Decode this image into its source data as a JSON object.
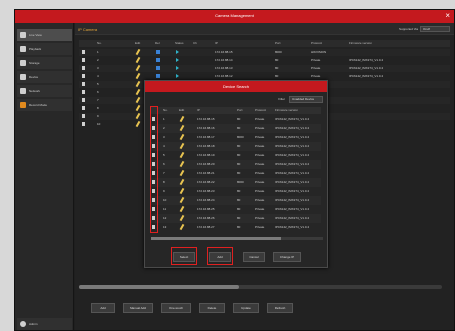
{
  "window": {
    "title": "Camera Management"
  },
  "sidebar": {
    "items": [
      {
        "label": "Live View"
      },
      {
        "label": "Playback"
      },
      {
        "label": "Storage"
      },
      {
        "label": "Device"
      },
      {
        "label": "Network"
      },
      {
        "label": "Record Mode"
      }
    ],
    "user": "Admin"
  },
  "main": {
    "tab": "IP Camera",
    "filter_label": "Supported Via",
    "filter_value": "Onvif",
    "columns": [
      "",
      "No.",
      "Edit",
      "Del",
      "Status",
      "Ch",
      "IP",
      "Port",
      "Protocol",
      "Firmware version"
    ],
    "rows": [
      {
        "no": "1",
        "ip": "172.16.88.15",
        "port": "8000",
        "protocol": "HIKVISION",
        "firmware": ""
      },
      {
        "no": "2",
        "ip": "172.16.88.14",
        "port": "80",
        "protocol": "Private",
        "firmware": "IPC6142_IMX274_V1.0.4"
      },
      {
        "no": "3",
        "ip": "172.16.88.13",
        "port": "80",
        "protocol": "Private",
        "firmware": "IPC6142_IMX274_V1.0.4"
      },
      {
        "no": "4",
        "ip": "172.16.88.12",
        "port": "80",
        "protocol": "Private",
        "firmware": "IPC6142_IMX274_V1.0.4"
      },
      {
        "no": "5",
        "ip": "",
        "port": "",
        "protocol": "Private",
        "firmware": ""
      },
      {
        "no": "6",
        "ip": "",
        "port": "",
        "protocol": "Private",
        "firmware": ""
      },
      {
        "no": "7",
        "ip": "",
        "port": "",
        "protocol": "Private",
        "firmware": ""
      },
      {
        "no": "8",
        "ip": "",
        "port": "",
        "protocol": "Private",
        "firmware": ""
      },
      {
        "no": "9",
        "ip": "",
        "port": "",
        "protocol": "Private",
        "firmware": ""
      },
      {
        "no": "10",
        "ip": "",
        "port": "",
        "protocol": "Private",
        "firmware": ""
      }
    ],
    "buttons": [
      "Add",
      "Manual Add",
      "One-touch",
      "Delete",
      "Update",
      "Refresh"
    ]
  },
  "modal": {
    "title": "Device Search",
    "filter_label": "Filter",
    "filter_value": "Unadded Device",
    "columns": [
      "",
      "No.",
      "Edit",
      "IP",
      "Port",
      "Protocol",
      "Firmware version"
    ],
    "rows": [
      {
        "no": "1",
        "ip": "172.16.88.15",
        "port": "80",
        "protocol": "Private",
        "firmware": "IPC6142_IMX274_V1.0.4"
      },
      {
        "no": "2",
        "ip": "172.16.88.16",
        "port": "80",
        "protocol": "Private",
        "firmware": "IPC6142_IMX274_V1.0.4"
      },
      {
        "no": "3",
        "ip": "172.16.88.17",
        "port": "8000",
        "protocol": "Private",
        "firmware": "IPC6142_IMX274_V1.0.4"
      },
      {
        "no": "4",
        "ip": "172.16.88.18",
        "port": "80",
        "protocol": "Private",
        "firmware": "IPC6142_IMX274_V1.0.4"
      },
      {
        "no": "5",
        "ip": "172.16.88.19",
        "port": "80",
        "protocol": "Private",
        "firmware": "IPC6142_IMX274_V1.0.4"
      },
      {
        "no": "6",
        "ip": "172.16.88.20",
        "port": "80",
        "protocol": "Private",
        "firmware": "IPC6142_IMX274_V1.0.4"
      },
      {
        "no": "7",
        "ip": "172.16.88.21",
        "port": "80",
        "protocol": "Private",
        "firmware": "IPC6142_IMX274_V1.0.4"
      },
      {
        "no": "8",
        "ip": "172.16.88.22",
        "port": "8000",
        "protocol": "Private",
        "firmware": "IPC6142_IMX274_V1.0.4"
      },
      {
        "no": "9",
        "ip": "172.16.88.23",
        "port": "80",
        "protocol": "Private",
        "firmware": "IPC6142_IMX274_V1.0.4"
      },
      {
        "no": "10",
        "ip": "172.16.88.24",
        "port": "80",
        "protocol": "Private",
        "firmware": "IPC6142_IMX274_V1.0.4"
      },
      {
        "no": "11",
        "ip": "172.16.88.25",
        "port": "80",
        "protocol": "Private",
        "firmware": "IPC6142_IMX274_V1.0.4"
      },
      {
        "no": "12",
        "ip": "172.16.88.26",
        "port": "80",
        "protocol": "Private",
        "firmware": "IPC6142_IMX274_V1.0.4"
      },
      {
        "no": "13",
        "ip": "172.16.88.27",
        "port": "80",
        "protocol": "Private",
        "firmware": "IPC6142_IMX274_V1.0.4"
      }
    ],
    "buttons": [
      "Select",
      "Add",
      "Cancel",
      "Change IP"
    ]
  },
  "colors": {
    "accent": "#c4191e",
    "highlight": "#e02020",
    "tab": "#e2a53a"
  }
}
